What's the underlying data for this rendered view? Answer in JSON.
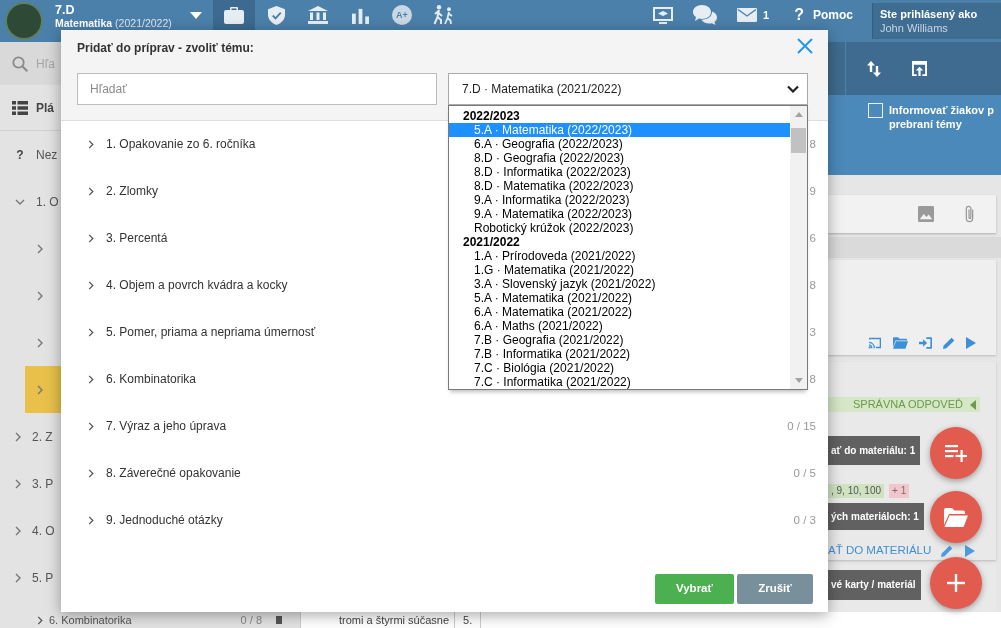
{
  "app_bar": {
    "class_name": "7.D",
    "subject": "**Matematika** (2021/2022)",
    "nav_tabs": [
      {
        "selected": true
      },
      {
        "selected": false
      },
      {
        "selected": false
      },
      {
        "selected": false
      },
      {
        "selected": false,
        "label": "A+"
      },
      {
        "selected": false
      }
    ],
    "mail_count": "1",
    "help": {
      "icon": "?",
      "label": "Pomoc"
    },
    "user": {
      "caption": "Ste prihlásený ako",
      "name": "John Williams"
    }
  },
  "sidebar": {
    "search_placeholder": "Hľa",
    "plan_label": "Plá",
    "unassigned": {
      "icon": "?",
      "label": "Nez"
    },
    "topics": [
      {
        "label": "1. O",
        "expanded": true,
        "selected": false,
        "children": [
          {
            "expanded": false,
            "selected": false
          },
          {
            "expanded": false,
            "selected": false
          },
          {
            "expanded": false,
            "selected": false
          },
          {
            "expanded": false,
            "selected": true
          }
        ]
      },
      {
        "label": "2. Z",
        "expanded": false,
        "selected": false
      },
      {
        "label": "3. P",
        "expanded": false,
        "selected": false
      },
      {
        "label": "4. O",
        "expanded": false,
        "selected": false
      },
      {
        "label": "5. P",
        "expanded": false,
        "selected": false
      }
    ]
  },
  "right_panel": {
    "notify": {
      "checked": false,
      "lines": [
        "Informovať žiakov p",
        "prebraní témy"
      ]
    },
    "answer_label": "SPRÁVNA ODPOVEĎ",
    "add_hint": "ať do materiálu: 1",
    "tags": [
      {
        "label": ", 9, 10, 100",
        "kind": "correct"
      },
      {
        "label": "+ 1",
        "kind": "extra"
      }
    ],
    "usage_hint": "ých materiáloch: 1",
    "add_link": "AŤ DO MATERIÁLU",
    "cards_hint": "vé karty / materiál"
  },
  "bottom_strip": {
    "topic": "6. Kombinatorika",
    "count": "0 / 8",
    "text": "tromi a štyrmi súčasne",
    "number": "5."
  },
  "dialog": {
    "title": "Pridať do príprav - zvoliť tému:",
    "search_placeholder": "Hľadať",
    "select_value": "7.D · Matematika (2021/2022)",
    "dropdown": {
      "groups": [
        {
          "label": "2022/2023",
          "options": [
            {
              "label": "5.A · Matematika (2022/2023)",
              "selected": true
            },
            {
              "label": "6.A · Geografia (2022/2023)",
              "selected": false
            },
            {
              "label": "8.D · Geografia (2022/2023)",
              "selected": false
            },
            {
              "label": "8.D · Informatika (2022/2023)",
              "selected": false
            },
            {
              "label": "8.D · Matematika (2022/2023)",
              "selected": false
            },
            {
              "label": "9.A · Informatika (2022/2023)",
              "selected": false
            },
            {
              "label": "9.A · Matematika (2022/2023)",
              "selected": false
            },
            {
              "label": "Robotický krúžok (2022/2023)",
              "selected": false
            }
          ]
        },
        {
          "label": "2021/2022",
          "options": [
            {
              "label": "1.A · Prírodoveda (2021/2022)",
              "selected": false
            },
            {
              "label": "1.G · Matematika (2021/2022)",
              "selected": false
            },
            {
              "label": "3.A · Slovenský jazyk (2021/2022)",
              "selected": false
            },
            {
              "label": "5.A · Matematika (2021/2022)",
              "selected": false
            },
            {
              "label": "6.A · Matematika (2021/2022)",
              "selected": false
            },
            {
              "label": "6.A · Maths (2021/2022)",
              "selected": false
            },
            {
              "label": "7.B · Geografia (2021/2022)",
              "selected": false
            },
            {
              "label": "7.B · Informatika (2021/2022)",
              "selected": false
            },
            {
              "label": "7.C · Biológia (2021/2022)",
              "selected": false
            },
            {
              "label": "7.C · Informatika (2021/2022)",
              "selected": false
            }
          ]
        }
      ]
    },
    "topics": [
      {
        "label": "1. Opakovanie zo 6. ročníka",
        "count": "8",
        "expanded": false
      },
      {
        "label": "2. Zlomky",
        "count": "9",
        "expanded": false
      },
      {
        "label": "3. Percentá",
        "count": "6",
        "expanded": false
      },
      {
        "label": "4. Objem a povrch kvádra a kocky",
        "count": "8",
        "expanded": false
      },
      {
        "label": "5. Pomer, priama a nepriama úmernosť",
        "count": "3",
        "expanded": false
      },
      {
        "label": "6. Kombinatorika",
        "count": "8",
        "expanded": false
      },
      {
        "label": "7. Výraz a jeho úprava",
        "count": "0 / 15",
        "expanded": false
      },
      {
        "label": "8. Záverečné opakovanie",
        "count": "0 / 5",
        "expanded": false
      },
      {
        "label": "9. Jednoduché otázky",
        "count": "0 / 3",
        "expanded": false
      }
    ],
    "buttons": [
      {
        "label": "Vybrať",
        "kind": "confirm"
      },
      {
        "label": "Zrušiť",
        "kind": "cancel"
      }
    ]
  }
}
